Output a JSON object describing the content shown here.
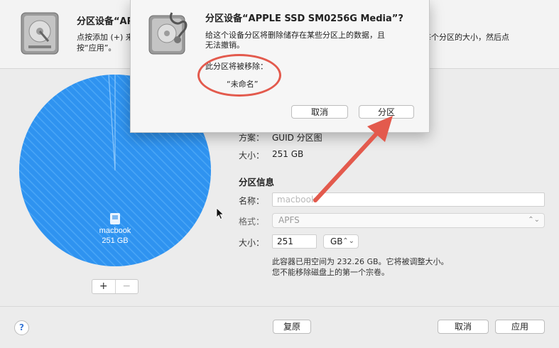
{
  "header": {
    "title": "分区设备“AP",
    "desc_line1": "点按添加 (+) 来",
    "desc_line2": "按“应用”。",
    "desc_right": "每个分区的大小，然后点"
  },
  "pie": {
    "volume_name": "macbook",
    "volume_size": "251 GB",
    "color": "#2f93f0",
    "add_button": "+",
    "remove_button": "−"
  },
  "device_info": {
    "scheme_label": "方案：",
    "scheme_value": "GUID 分区图",
    "size_label": "大小：",
    "size_value": "251 GB"
  },
  "partition_info": {
    "section_title": "分区信息",
    "name_label": "名称：",
    "name_placeholder": "macbook",
    "format_label": "格式：",
    "format_value": "APFS",
    "size_label": "大小：",
    "size_value": "251",
    "size_unit": "GB",
    "note_line1": "此容器已用空间为 232.26 GB。它将被调整大小。",
    "note_line2": "您不能移除磁盘上的第一个宗卷。"
  },
  "bottom": {
    "help": "?",
    "revert_button": "复原",
    "cancel_button": "取消",
    "apply_button": "应用"
  },
  "dialog": {
    "title": "分区设备“APPLE SSD SM0256G Media”?",
    "message_line1": "给这个设备分区将删除储存在某些分区上的数据，且",
    "message_line2": "无法撤销。",
    "sub_label": "此分区将被移除：",
    "removed_name": "“未命名”",
    "cancel_button": "取消",
    "confirm_button": "分区"
  },
  "annotations": {
    "highlight_color": "#e35a4d",
    "arrow_color": "#e35a4d"
  },
  "icons": {
    "disk_utility": "disk-utility-icon",
    "pointer": "mouse-pointer-icon",
    "volume": "volume-icon",
    "chevrons": "chevron-updown-icon"
  }
}
